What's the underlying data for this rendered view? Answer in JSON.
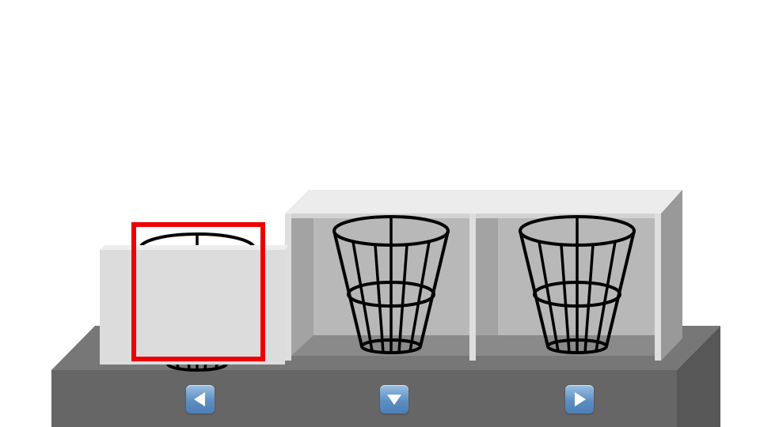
{
  "scene": {
    "slots": [
      {
        "id": "slot-left",
        "item": "basket-icon",
        "state": "covered",
        "selected": true
      },
      {
        "id": "slot-middle",
        "item": "basket-icon",
        "state": "open",
        "selected": false
      },
      {
        "id": "slot-right",
        "item": "basket-icon",
        "state": "open",
        "selected": false
      }
    ],
    "selection_color": "#ee0000"
  },
  "controls": {
    "left": {
      "icon": "arrow-left-icon"
    },
    "down": {
      "icon": "arrow-down-icon"
    },
    "right": {
      "icon": "arrow-right-icon"
    }
  }
}
